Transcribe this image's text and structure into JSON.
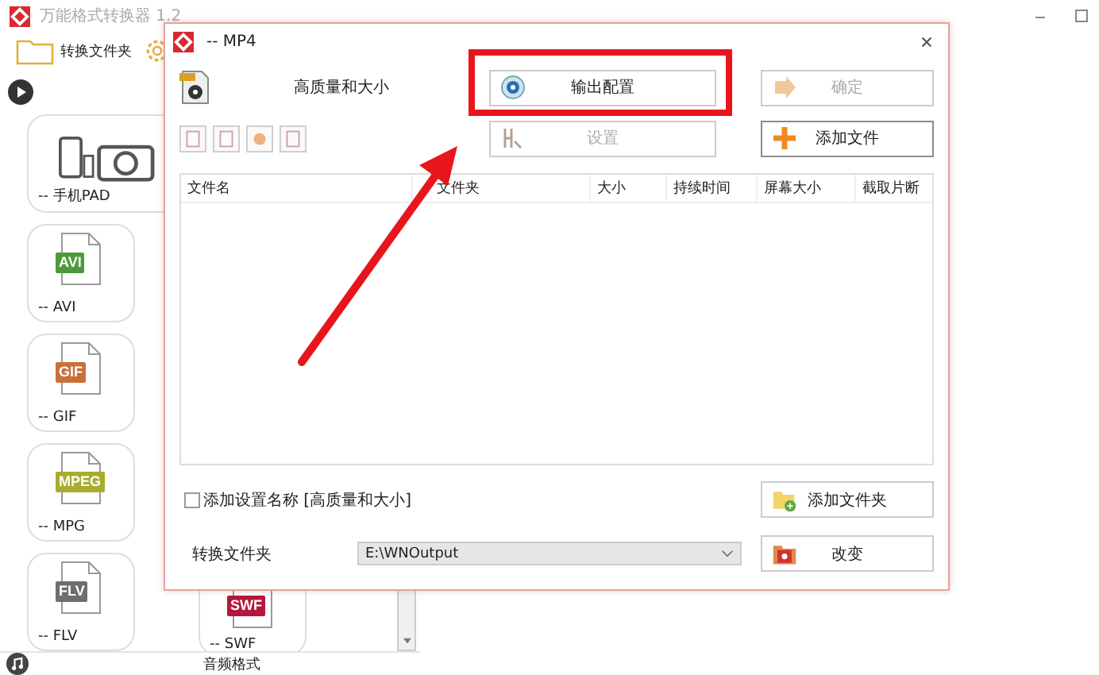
{
  "app": {
    "title": "万能格式转换器 1.2",
    "toolbar": {
      "folder_label": "转换文件夹"
    },
    "format_cards": [
      {
        "kind": "device",
        "label": "-- 手机PAD"
      },
      {
        "kind": "file",
        "badge": "AVI",
        "color": "#4c9a3c",
        "label": "-- AVI"
      },
      {
        "kind": "file",
        "badge": "GIF",
        "color": "#c8703a",
        "label": "-- GIF"
      },
      {
        "kind": "file",
        "badge": "MPEG",
        "color": "#a9ac2e",
        "label": "-- MPG"
      },
      {
        "kind": "file",
        "badge": "FLV",
        "color": "#6e6e6e",
        "label": "-- FLV"
      }
    ],
    "format_cards_col2": [
      {
        "kind": "file",
        "badge": "SWF",
        "color": "#b5173c",
        "label": "-- SWF"
      }
    ],
    "bottom_bar": {
      "label": "音频格式"
    }
  },
  "dialog": {
    "title": "-- MP4",
    "preset": "高质量和大小",
    "output_config": {
      "label": "输出配置",
      "disabled": false
    },
    "ok": {
      "label": "确定",
      "disabled": true
    },
    "settings": {
      "label": "设置",
      "disabled": true
    },
    "add_file": {
      "label": "添加文件",
      "disabled": false
    },
    "table": {
      "columns": [
        "文件名",
        "文件夹",
        "大小",
        "持续时间",
        "屏幕大小",
        "截取片断"
      ]
    },
    "checkbox": {
      "label": "添加设置名称 [高质量和大小]",
      "checked": false
    },
    "folder_label": "转换文件夹",
    "folder_value": "E:\\WNOutput",
    "add_folder": {
      "label": "添加文件夹",
      "disabled": false
    },
    "change": {
      "label": "改变",
      "disabled": false
    }
  }
}
